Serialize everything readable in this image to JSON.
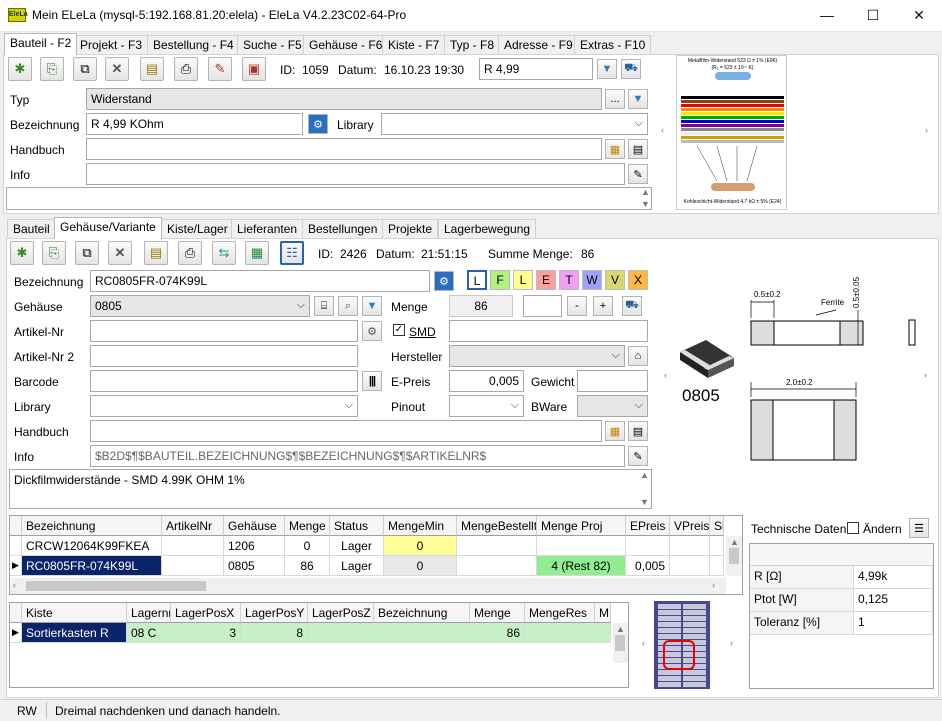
{
  "window": {
    "title": "Mein ELeLa (mysql-5:192.168.81.20:elela) - EleLa V4.2.23C02-64-Pro",
    "app_icon_text": "EleLa",
    "min": "—",
    "max": "☐",
    "close": "✕"
  },
  "main_tabs": [
    "Bauteil - F2",
    "Projekt - F3",
    "Bestellung - F4",
    "Suche - F5",
    "Gehäuse - F6",
    "Kiste - F7",
    "Typ - F8",
    "Adresse - F9",
    "Extras - F10"
  ],
  "bauteil": {
    "id_label": "ID:",
    "id": "1059",
    "datum_label": "Datum:",
    "datum": "16.10.23 19:30",
    "search_value": "R 4,99",
    "typ_label": "Typ",
    "typ": "Widerstand",
    "typ_btn": "...",
    "bezeichnung_label": "Bezeichnung",
    "bezeichnung": "R 4,99 KOhm",
    "library_label": "Library",
    "library": "",
    "handbuch_label": "Handbuch",
    "handbuch": "",
    "info_label": "Info",
    "info": "",
    "notes": ""
  },
  "datasheet_image": {
    "title": "Metallfilm-Widerstand 523 Ω ± 1% (E96)",
    "subtitle": "(R₁ = 523 ± 10·⁷ K)",
    "caption": "Kohleschicht-Widerstand 4,7 kΩ ± 5% (E24)"
  },
  "sub_tabs": [
    "Bauteil",
    "Gehäuse/Variante",
    "Kiste/Lager",
    "Lieferanten",
    "Bestellungen",
    "Projekte",
    "Lagerbewegung"
  ],
  "variante": {
    "id_label": "ID:",
    "id": "2426",
    "datum_label": "Datum:",
    "datum": "21:51:15",
    "summe_label": "Summe Menge:",
    "summe": "86",
    "bezeichnung_label": "Bezeichnung",
    "bezeichnung": "RC0805FR-074K99L",
    "letters": [
      {
        "t": "L",
        "c": "#ffffff"
      },
      {
        "t": "F",
        "c": "#b0f080"
      },
      {
        "t": "L",
        "c": "#ffff90"
      },
      {
        "t": "E",
        "c": "#f8a0a0"
      },
      {
        "t": "T",
        "c": "#f0a0f0"
      },
      {
        "t": "W",
        "c": "#a0a0ff"
      },
      {
        "t": "V",
        "c": "#d8d870"
      },
      {
        "t": "X",
        "c": "#ffb840"
      }
    ],
    "gehaeuse_label": "Gehäuse",
    "gehaeuse": "0805",
    "menge_label": "Menge",
    "menge": "86",
    "menge_step": "",
    "minus": "-",
    "plus": "+",
    "artikelnr_label": "Artikel-Nr",
    "artikelnr": "",
    "smd_label": "SMD",
    "smd_checked": true,
    "smd_value": "",
    "artikelnr2_label": "Artikel-Nr 2",
    "artikelnr2": "",
    "hersteller_label": "Hersteller",
    "hersteller": "",
    "barcode_label": "Barcode",
    "barcode": "",
    "epreis_label": "E-Preis",
    "epreis": "0,005",
    "gewicht_label": "Gewicht",
    "gewicht": "",
    "library_label": "Library",
    "library": "",
    "pinout_label": "Pinout",
    "pinout": "",
    "bware_label": "BWare",
    "bware": "",
    "handbuch_label": "Handbuch",
    "handbuch": "",
    "info_label": "Info",
    "info": "$B2D$¶$BAUTEIL.BEZEICHNUNG$¶$BEZEICHNUNG$¶$ARTIKELNR$",
    "description": "Dickfilmwiderstände - SMD 4.99K OHM 1%"
  },
  "package_image": {
    "label": "0805",
    "dim_top": "0.5±0.2",
    "dim_side": "0.5±0.05",
    "ferrite": "Ferrite",
    "dim_bottom": "2.0±0.2"
  },
  "variants_table": {
    "headers": [
      "Bezeichnung",
      "ArtikelNr",
      "Gehäuse",
      "Menge",
      "Status",
      "MengeMin",
      "MengeBestellt",
      "Menge Proj",
      "EPreis",
      "VPreis",
      "Sl"
    ],
    "rows": [
      [
        "CRCW12064K99FKEA",
        "",
        "1206",
        "0",
        "Lager",
        "0",
        "",
        "",
        "",
        "",
        ""
      ],
      [
        "RC0805FR-074K99L",
        "",
        "0805",
        "86",
        "Lager",
        "0",
        "",
        "4 (Rest 82)",
        "0,005",
        "",
        ""
      ]
    ]
  },
  "tech_data": {
    "title": "Technische Daten:",
    "aendern": "Ändern",
    "rows": [
      [
        "R [Ω]",
        "4,99k"
      ],
      [
        "Ptot [W]",
        "0,125"
      ],
      [
        "Toleranz [%]",
        "1"
      ]
    ]
  },
  "lager_table": {
    "headers": [
      "Kiste",
      "Lagernr",
      "LagerPosX",
      "LagerPosY",
      "LagerPosZ",
      "Bezeichnung",
      "Menge",
      "MengeRes",
      "M"
    ],
    "rows": [
      [
        "Sortierkasten R",
        "08 C",
        "3",
        "8",
        "",
        "",
        "86",
        "",
        ""
      ]
    ]
  },
  "status": {
    "mode": "RW",
    "message": "Dreimal nachdenken und danach handeln."
  }
}
